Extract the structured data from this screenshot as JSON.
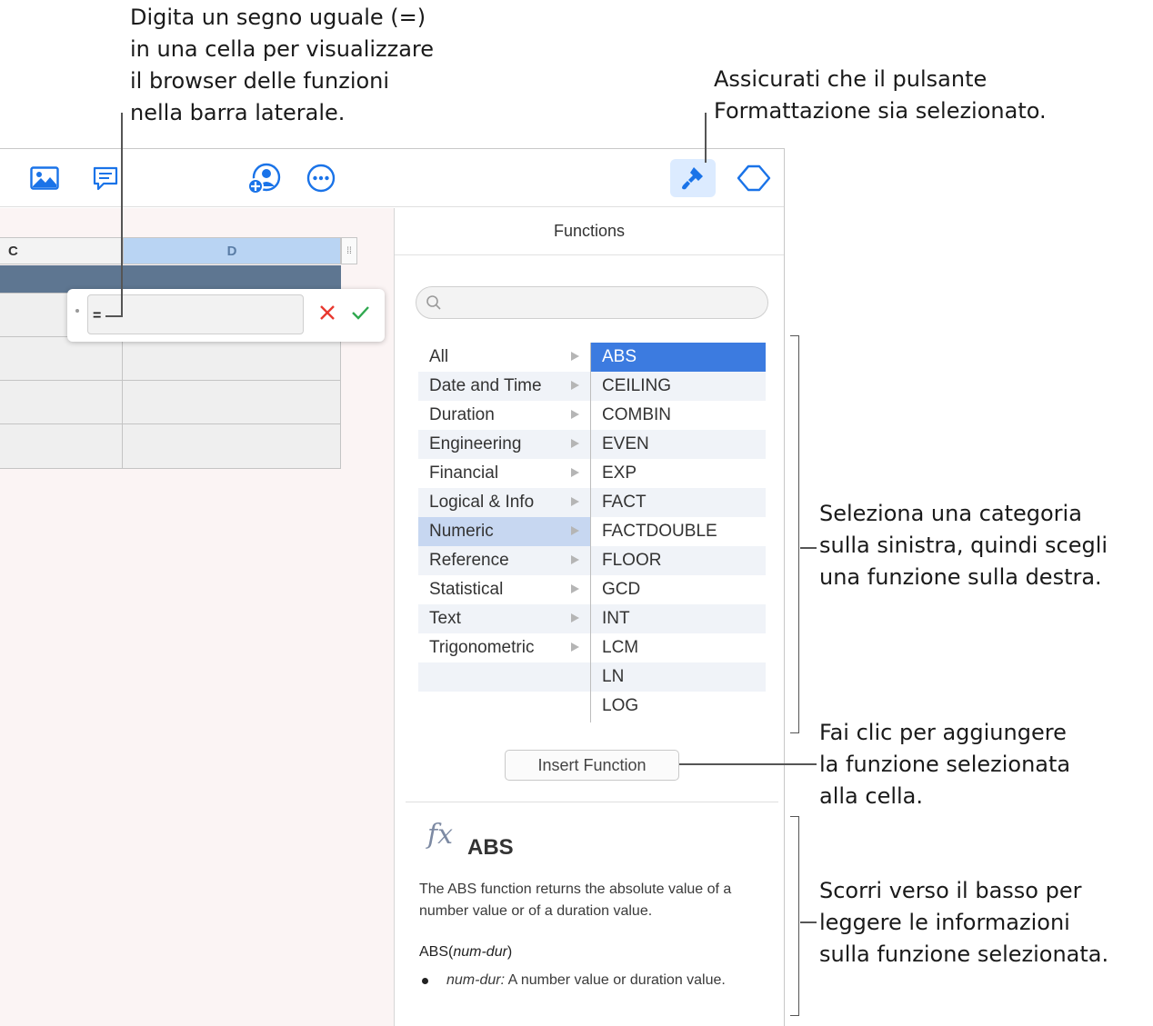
{
  "callouts": {
    "equals": "Digita un segno uguale (=)\nin una cella per visualizzare\nil browser delle funzioni\nnella barra laterale.",
    "format": "Assicurati che il pulsante\nFormattazione sia selezionato.",
    "category": "Seleziona una categoria\nsulla sinistra, quindi scegli\nuna funzione sulla destra.",
    "insert": "Fai clic per aggiungere\nla funzione selezionata\nalla cella.",
    "scroll": "Scorri verso il basso per\nleggere le informazioni\nsulla funzione selezionata."
  },
  "toolbar": {
    "icons": [
      "image-icon",
      "comment-icon",
      "collaborate-icon",
      "more-icon",
      "format-brush-icon",
      "organize-icon"
    ],
    "accent": "#1a73e8",
    "active_bg": "#dcebff"
  },
  "sheet": {
    "col_c": "C",
    "col_d": "D",
    "formula_value": "="
  },
  "sidebar": {
    "title": "Functions",
    "search_placeholder": "",
    "categories": [
      "All",
      "Date and Time",
      "Duration",
      "Engineering",
      "Financial",
      "Logical & Info",
      "Numeric",
      "Reference",
      "Statistical",
      "Text",
      "Trigonometric"
    ],
    "selected_category": "Numeric",
    "functions": [
      "ABS",
      "CEILING",
      "COMBIN",
      "EVEN",
      "EXP",
      "FACT",
      "FACTDOUBLE",
      "FLOOR",
      "GCD",
      "INT",
      "LCM",
      "LN",
      "LOG"
    ],
    "selected_function": "ABS",
    "insert_label": "Insert Function",
    "info": {
      "fx": "fx",
      "name": "ABS",
      "description": "The ABS function returns the absolute value of a number value or of a duration value.",
      "syntax_name": "ABS(",
      "syntax_arg": "num-dur",
      "syntax_close": ")",
      "bullet_arg": "num-dur:",
      "bullet_text": " A number value or duration value."
    }
  }
}
